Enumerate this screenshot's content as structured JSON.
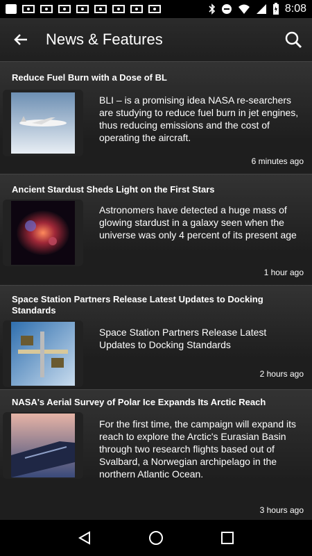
{
  "status_bar": {
    "time": "8:08",
    "icons": [
      "notification-icon",
      "mail-icon",
      "mail-icon",
      "mail-icon",
      "mail-icon",
      "mail-icon",
      "mail-icon",
      "mail-icon",
      "mail-icon",
      "bluetooth-icon",
      "minus-icon",
      "wifi-icon",
      "signal-icon",
      "battery-icon"
    ]
  },
  "toolbar": {
    "title": "News & Features",
    "back_icon": "back-arrow-icon",
    "search_icon": "search-icon"
  },
  "articles": [
    {
      "headline": "Reduce Fuel Burn with a Dose of BL",
      "summary": "BLI – is a promising idea NASA re-searchers are studying to reduce fuel burn in jet engines, thus reducing emissions and the cost of operating the aircraft.",
      "time": "6 minutes ago",
      "thumbnail": "aircraft-thumbnail"
    },
    {
      "headline": "Ancient Stardust Sheds Light on the First Stars",
      "summary": "Astronomers have detected a huge mass of glowing stardust in a galaxy seen when the universe was only 4 percent of its present age",
      "time": "1 hour ago",
      "thumbnail": "nebula-thumbnail"
    },
    {
      "headline": "Space Station Partners Release Latest Updates to Docking Standards",
      "summary": "Space Station Partners Release Latest Updates to Docking Standards",
      "time": "2 hours ago",
      "thumbnail": "space-station-thumbnail"
    },
    {
      "headline": "NASA's Aerial Survey of Polar Ice Expands Its Arctic Reach",
      "summary": "For the first time, the campaign will expand its reach to explore the Arctic's Eurasian Basin through two research flights based out of Svalbard, a Norwegian archipelago in the northern Atlantic Ocean.",
      "time": "3 hours ago",
      "thumbnail": "aircraft-wing-thumbnail"
    }
  ],
  "nav_bar": {
    "back": "nav-back-icon",
    "home": "nav-home-icon",
    "recents": "nav-recents-icon"
  }
}
